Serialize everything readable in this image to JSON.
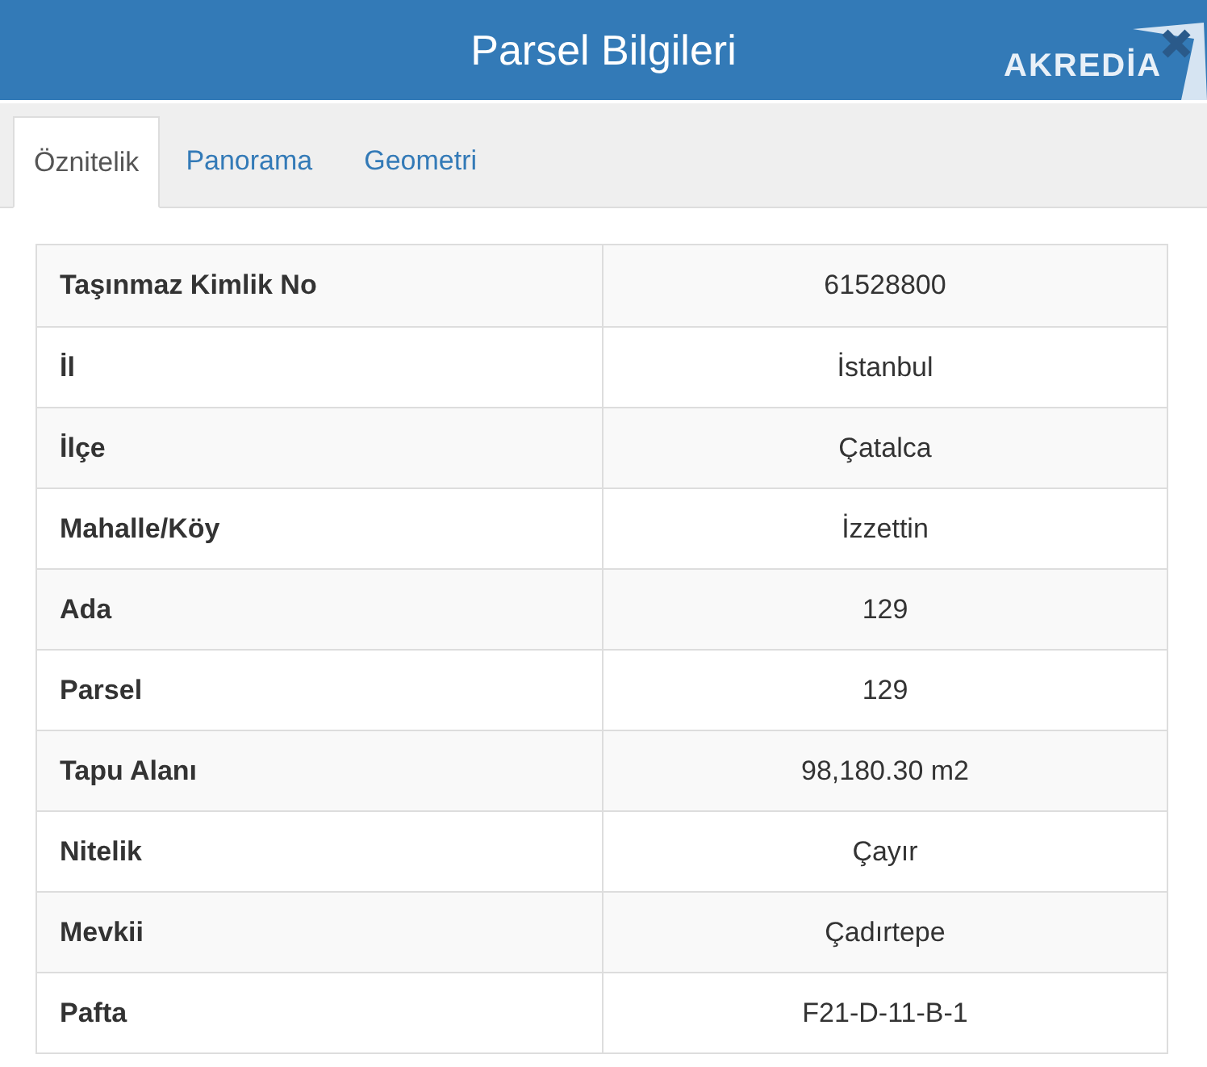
{
  "header": {
    "title": "Parsel Bilgileri",
    "logo": {
      "name": "AKREDİA"
    }
  },
  "tabs": [
    {
      "label": "Öznitelik",
      "selected": true
    },
    {
      "label": "Panorama",
      "selected": false
    },
    {
      "label": "Geometri",
      "selected": false
    }
  ],
  "table": {
    "rows": [
      {
        "label": "Taşınmaz Kimlik No",
        "value": "61528800"
      },
      {
        "label": "İl",
        "value": "İstanbul"
      },
      {
        "label": "İlçe",
        "value": "Çatalca"
      },
      {
        "label": "Mahalle/Köy",
        "value": "İzzettin"
      },
      {
        "label": "Ada",
        "value": "129"
      },
      {
        "label": "Parsel",
        "value": "129"
      },
      {
        "label": "Tapu Alanı",
        "value": "98,180.30 m2"
      },
      {
        "label": "Nitelik",
        "value": "Çayır"
      },
      {
        "label": "Mevkii",
        "value": "Çadırtepe"
      },
      {
        "label": "Pafta",
        "value": "F21-D-11-B-1"
      }
    ]
  }
}
